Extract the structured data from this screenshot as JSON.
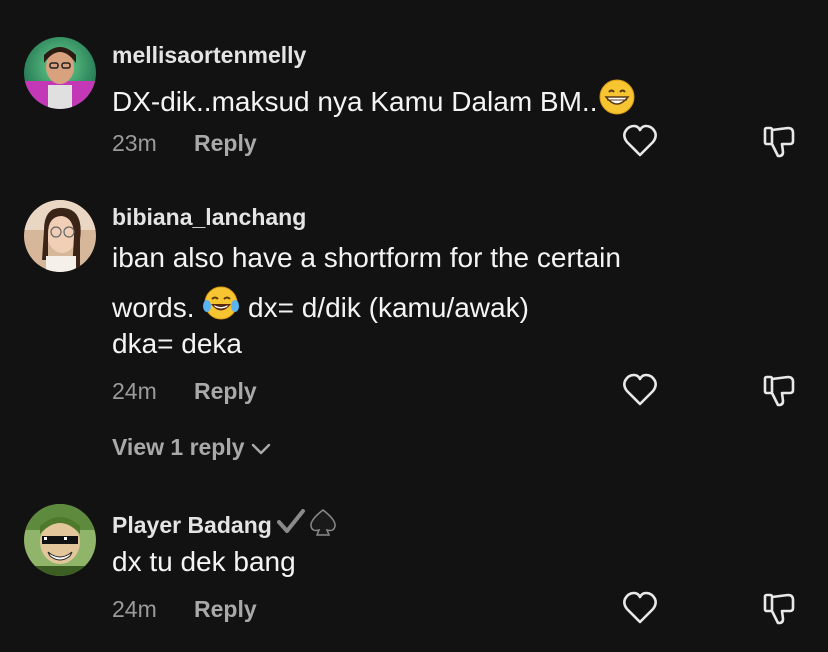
{
  "comments": [
    {
      "username": "mellisaortenmelly",
      "text_line1": "DX-dik..maksud nya Kamu Dalam BM..",
      "time": "23m",
      "reply_label": "Reply"
    },
    {
      "username": "bibiana_lanchang",
      "text_line1": "iban also have a shortform for the certain",
      "text_line2a": "words.",
      "text_line2b": "dx= d/dik (kamu/awak)",
      "text_line3": "dka= deka",
      "time": "24m",
      "reply_label": "Reply",
      "view_replies": "View 1 reply"
    },
    {
      "username": "Player Badang",
      "text_line1": "dx tu dek bang",
      "time": "24m",
      "reply_label": "Reply"
    }
  ],
  "icons": {
    "like": "heart-outline-icon",
    "dislike": "thumbs-down-outline-icon",
    "chevron": "chevron-down-icon",
    "grin_emoji": "grinning-emoji-icon",
    "laugh_emoji": "tears-of-joy-emoji-icon",
    "badge_check": "check-mark-icon",
    "badge_spade": "spade-icon"
  },
  "colors": {
    "background": "#121212",
    "text": "#f4f4f4",
    "muted": "#9a9a9a"
  }
}
